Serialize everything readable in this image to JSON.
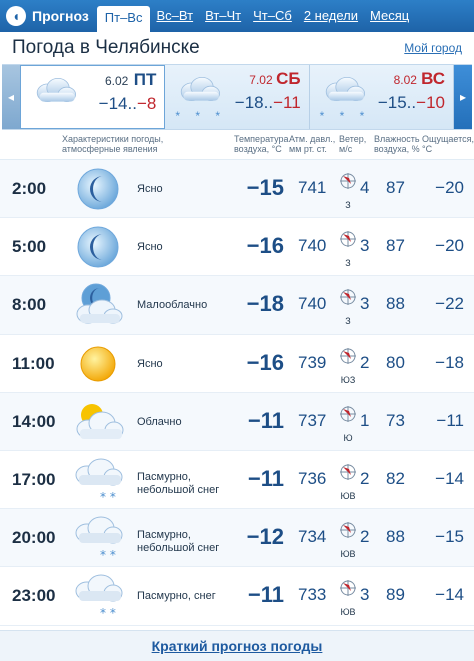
{
  "nav": {
    "brand": "Прогноз",
    "tabs": [
      "Пт–Вс",
      "Вс–Вт",
      "Вт–Чт",
      "Чт–Сб",
      "2 недели",
      "Месяц"
    ],
    "active_index": 0
  },
  "header": {
    "title": "Погода в Челябинске",
    "my_city": "Мой город"
  },
  "days": [
    {
      "date": "6.02",
      "dow": "ПТ",
      "weekend": false,
      "tmin": "−14..",
      "tmax": "−8",
      "snow": ""
    },
    {
      "date": "7.02",
      "dow": "СБ",
      "weekend": true,
      "tmin": "−18..",
      "tmax": "−11",
      "snow": "* * *"
    },
    {
      "date": "8.02",
      "dow": "ВС",
      "weekend": true,
      "tmin": "−15..",
      "tmax": "−10",
      "snow": "* * *"
    }
  ],
  "columns": {
    "cond": "Характеристики погоды,\nатмосферные явления",
    "temp": "Температура\nвоздуха, °C",
    "press": "Атм. давл.,\nмм рт. ст.",
    "wind": "Ветер,\nм/с",
    "hum": "Влажность\nвоздуха, %",
    "feel": "Ощущается,\n°C"
  },
  "rows": [
    {
      "time": "2:00",
      "icon": "moon-icon",
      "cond": "Ясно",
      "temp": "−15",
      "press": "741",
      "wind": "4",
      "wdir": "З",
      "hum": "87",
      "feel": "−20"
    },
    {
      "time": "5:00",
      "icon": "moon-icon",
      "cond": "Ясно",
      "temp": "−16",
      "press": "740",
      "wind": "3",
      "wdir": "З",
      "hum": "87",
      "feel": "−20"
    },
    {
      "time": "8:00",
      "icon": "moon-cloud-icon",
      "cond": "Малооблачно",
      "temp": "−18",
      "press": "740",
      "wind": "3",
      "wdir": "З",
      "hum": "88",
      "feel": "−22"
    },
    {
      "time": "11:00",
      "icon": "sun-icon",
      "cond": "Ясно",
      "temp": "−16",
      "press": "739",
      "wind": "2",
      "wdir": "ЮЗ",
      "hum": "80",
      "feel": "−18"
    },
    {
      "time": "14:00",
      "icon": "sun-cloud-icon",
      "cond": "Облачно",
      "temp": "−11",
      "press": "737",
      "wind": "1",
      "wdir": "Ю",
      "hum": "73",
      "feel": "−11"
    },
    {
      "time": "17:00",
      "icon": "cloud-snow-icon",
      "cond": "Пасмурно,\nнебольшой снег",
      "temp": "−11",
      "press": "736",
      "wind": "2",
      "wdir": "ЮВ",
      "hum": "82",
      "feel": "−14"
    },
    {
      "time": "20:00",
      "icon": "cloud-snow-icon",
      "cond": "Пасмурно,\nнебольшой снег",
      "temp": "−12",
      "press": "734",
      "wind": "2",
      "wdir": "ЮВ",
      "hum": "88",
      "feel": "−15"
    },
    {
      "time": "23:00",
      "icon": "cloud-snow-icon",
      "cond": "Пасмурно, снег",
      "temp": "−11",
      "press": "733",
      "wind": "3",
      "wdir": "ЮВ",
      "hum": "89",
      "feel": "−14"
    }
  ],
  "footer": {
    "link": "Краткий прогноз погоды"
  },
  "colors": {
    "accent": "#1e63a8",
    "red": "#c0262d",
    "value": "#1d4e86"
  }
}
